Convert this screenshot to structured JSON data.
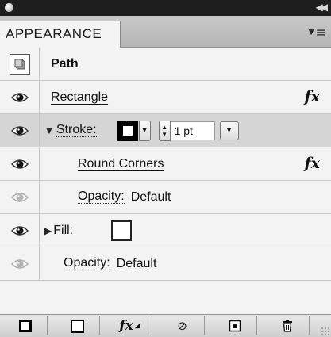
{
  "panel": {
    "tab_label": "APPEARANCE"
  },
  "rows": {
    "path_label": "Path",
    "rectangle_label": "Rectangle",
    "stroke_label": "Stroke:",
    "stroke_weight": "1 pt",
    "round_corners_label": "Round Corners",
    "opacity1_label": "Opacity:",
    "opacity1_value": "Default",
    "fill_label": "Fill:",
    "opacity2_label": "Opacity:",
    "opacity2_value": "Default"
  },
  "fx_symbol": "fx",
  "toolbar": {
    "fx_symbol": "fx",
    "no_symbol": "⊘",
    "trash_symbol": "🗑"
  },
  "icons": [
    "close-icon",
    "collapse-icon",
    "panel-menu-icon",
    "visibility-eye-icon",
    "path-thumbnail-icon",
    "disclosure-triangle-icon",
    "stroke-swatch-icon",
    "fill-swatch-icon",
    "add-stroke-icon",
    "add-fill-icon",
    "fx-menu-icon",
    "clear-appearance-icon",
    "duplicate-item-icon",
    "delete-item-icon",
    "resize-grip-icon"
  ],
  "colors": {
    "panel_bg": "#f3f3f3",
    "selected_row_bg": "#d5d5d5",
    "topbar_bg": "#1e1e1e"
  }
}
